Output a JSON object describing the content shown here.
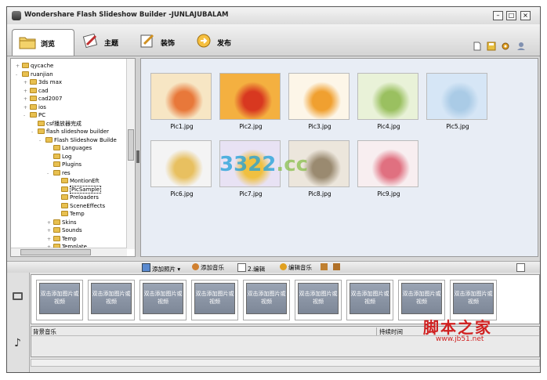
{
  "window": {
    "title": "Wondershare Flash Slideshow Builder -JUNLAJUBALAM"
  },
  "tabs": [
    {
      "label": "浏览",
      "icon": "folder-icon",
      "active": true
    },
    {
      "label": "主题",
      "icon": "theme-brush-icon",
      "active": false
    },
    {
      "label": "装饰",
      "icon": "decorate-pencil-icon",
      "active": false
    },
    {
      "label": "发布",
      "icon": "publish-icon",
      "active": false
    }
  ],
  "tree": [
    {
      "label": "qycache",
      "level": 1,
      "expander": "+"
    },
    {
      "label": "ruanjian",
      "level": 1,
      "expander": "-"
    },
    {
      "label": "3ds max",
      "level": 2,
      "expander": "+"
    },
    {
      "label": "cad",
      "level": 2,
      "expander": "+"
    },
    {
      "label": "cad2007",
      "level": 2,
      "expander": "+"
    },
    {
      "label": "ios",
      "level": 2,
      "expander": "+"
    },
    {
      "label": "PC",
      "level": 2,
      "expander": "-"
    },
    {
      "label": "csf播放器完成",
      "level": 3,
      "expander": ""
    },
    {
      "label": "flash slideshow builder",
      "level": 3,
      "expander": "-"
    },
    {
      "label": "Flash Slideshow Builde",
      "level": 4,
      "expander": "-"
    },
    {
      "label": "Languages",
      "level": 5,
      "expander": ""
    },
    {
      "label": "Log",
      "level": 5,
      "expander": ""
    },
    {
      "label": "Plugins",
      "level": 5,
      "expander": ""
    },
    {
      "label": "res",
      "level": 5,
      "expander": "-"
    },
    {
      "label": "MontionEft",
      "level": 6,
      "expander": ""
    },
    {
      "label": "PicSample",
      "level": 6,
      "expander": "",
      "selected": true
    },
    {
      "label": "Preloaders",
      "level": 6,
      "expander": ""
    },
    {
      "label": "SceneEffects",
      "level": 6,
      "expander": ""
    },
    {
      "label": "Temp",
      "level": 6,
      "expander": ""
    },
    {
      "label": "Skins",
      "level": 5,
      "expander": "+"
    },
    {
      "label": "Sounds",
      "level": 5,
      "expander": "+"
    },
    {
      "label": "Temp",
      "level": 5,
      "expander": "+"
    },
    {
      "label": "Template",
      "level": 5,
      "expander": "+"
    }
  ],
  "photos": [
    {
      "name": "Pic1.jpg",
      "colors": [
        "#f7e6c4",
        "#e8783a"
      ]
    },
    {
      "name": "Pic2.jpg",
      "colors": [
        "#f4b040",
        "#d83820"
      ]
    },
    {
      "name": "Pic3.jpg",
      "colors": [
        "#fdf6e8",
        "#f0a030"
      ]
    },
    {
      "name": "Pic4.jpg",
      "colors": [
        "#e9f2d8",
        "#9ac060"
      ]
    },
    {
      "name": "Pic5.jpg",
      "colors": [
        "#d6e6f6",
        "#aacbe6"
      ]
    },
    {
      "name": "Pic6.jpg",
      "colors": [
        "#f4f4f4",
        "#e8c060"
      ]
    },
    {
      "name": "Pic7.jpg",
      "colors": [
        "#e8e2f4",
        "#f0c040"
      ]
    },
    {
      "name": "Pic8.jpg",
      "colors": [
        "#ece6dc",
        "#9a8a70"
      ]
    },
    {
      "name": "Pic9.jpg",
      "colors": [
        "#f8eef0",
        "#e07080"
      ]
    }
  ],
  "watermark": {
    "main": "3322",
    "suffix": ".cc"
  },
  "toolbar": {
    "add_photo": "添加照片",
    "add_music": "添加音乐",
    "edit2": "2.编辑",
    "edit_music": "编辑音乐"
  },
  "timeline": {
    "slot_text": "双击添加图片或视频",
    "slot_count": 9,
    "bg_music": "背景音乐",
    "duration": "持续时间"
  },
  "site": {
    "logo": "脚本之家",
    "url": "www.jb51.net"
  }
}
